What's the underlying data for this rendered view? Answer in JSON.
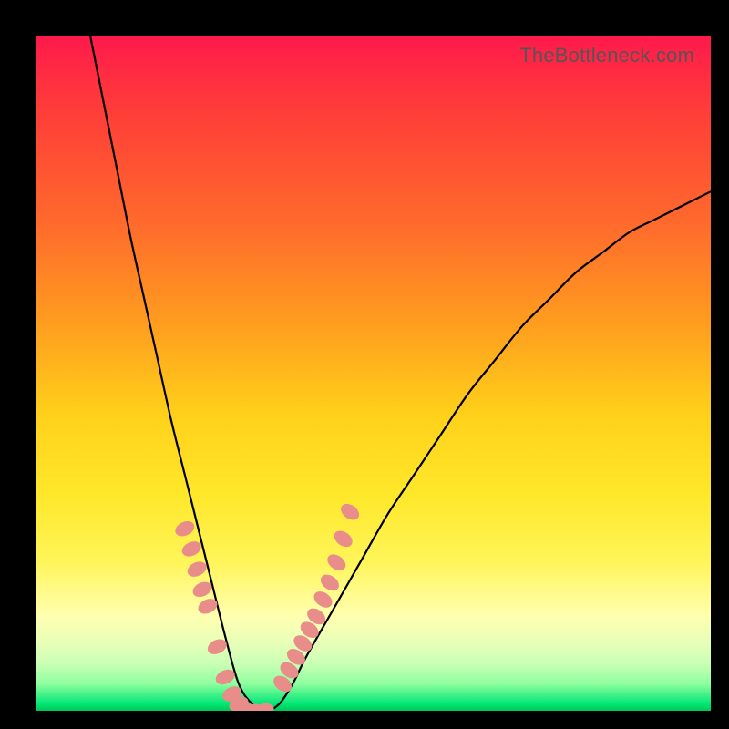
{
  "watermark": "TheBottleneck.com",
  "chart_data": {
    "type": "line",
    "title": "",
    "xlabel": "",
    "ylabel": "",
    "xlim": [
      0,
      100
    ],
    "ylim": [
      0,
      100
    ],
    "note": "Axes are unlabeled in the image; x and y ranges are normalized 0–100. y=0 is the bottom green edge, y=100 is the top red edge. The curve is a V-shaped bottleneck curve dipping to y≈0 near x≈30 and rising on both sides.",
    "series": [
      {
        "name": "bottleneck-curve",
        "x": [
          8,
          10,
          12,
          14,
          16,
          18,
          20,
          22,
          24,
          26,
          28,
          30,
          32,
          34,
          36,
          38,
          40,
          44,
          48,
          52,
          56,
          60,
          64,
          68,
          72,
          76,
          80,
          84,
          88,
          92,
          96,
          100
        ],
        "y": [
          100,
          90,
          80,
          70,
          61,
          52,
          43,
          35,
          27,
          19,
          11,
          4,
          1,
          0,
          1,
          4,
          8,
          15,
          22,
          29,
          35,
          41,
          47,
          52,
          57,
          61,
          65,
          68,
          71,
          73,
          75,
          77
        ]
      },
      {
        "name": "left-arm-markers",
        "x": [
          22.0,
          23.0,
          23.8,
          24.6,
          25.4,
          26.8,
          28.0,
          29.0,
          30.0
        ],
        "y": [
          27.0,
          24.0,
          21.0,
          18.0,
          15.5,
          9.5,
          5.0,
          2.5,
          1.0
        ]
      },
      {
        "name": "floor-markers",
        "x": [
          31.0,
          32.5,
          34.0
        ],
        "y": [
          0.4,
          0.2,
          0.3
        ]
      },
      {
        "name": "right-arm-markers",
        "x": [
          36.5,
          37.5,
          38.5,
          39.5,
          40.5,
          41.5,
          42.5,
          43.5,
          44.5,
          45.5,
          46.5
        ],
        "y": [
          4.0,
          6.0,
          8.0,
          10.0,
          12.0,
          14.0,
          16.5,
          19.0,
          22.0,
          25.5,
          29.5
        ]
      }
    ]
  }
}
